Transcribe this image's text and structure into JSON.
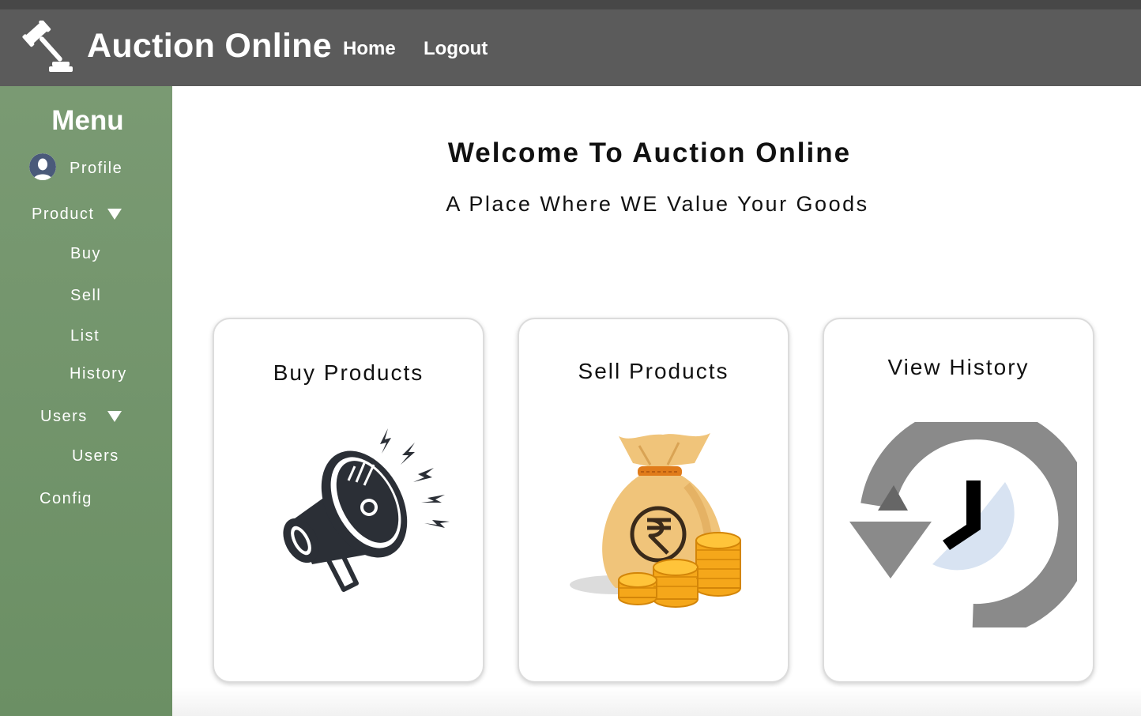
{
  "header": {
    "brand": "Auction Online",
    "logo_icon": "gavel-icon",
    "nav": [
      "Home",
      "Logout"
    ]
  },
  "sidebar": {
    "title": "Menu",
    "profile": "Profile",
    "product": {
      "label": "Product",
      "items": [
        "Buy",
        "Sell",
        "List",
        "History"
      ]
    },
    "users": {
      "label": "Users",
      "items": [
        "Users"
      ]
    },
    "config": "Config"
  },
  "main": {
    "title": "Welcome To Auction Online",
    "subtitle": "A Place Where WE Value Your Goods",
    "cards": [
      {
        "title": "Buy Products",
        "icon": "megaphone-icon"
      },
      {
        "title": "Sell Products",
        "icon": "money-bag-icon"
      },
      {
        "title": "View History",
        "icon": "history-clock-icon"
      }
    ]
  },
  "colors": {
    "header": "#5b5b5b",
    "sidebar": "#729669",
    "accent_gold": "#f2a516"
  }
}
